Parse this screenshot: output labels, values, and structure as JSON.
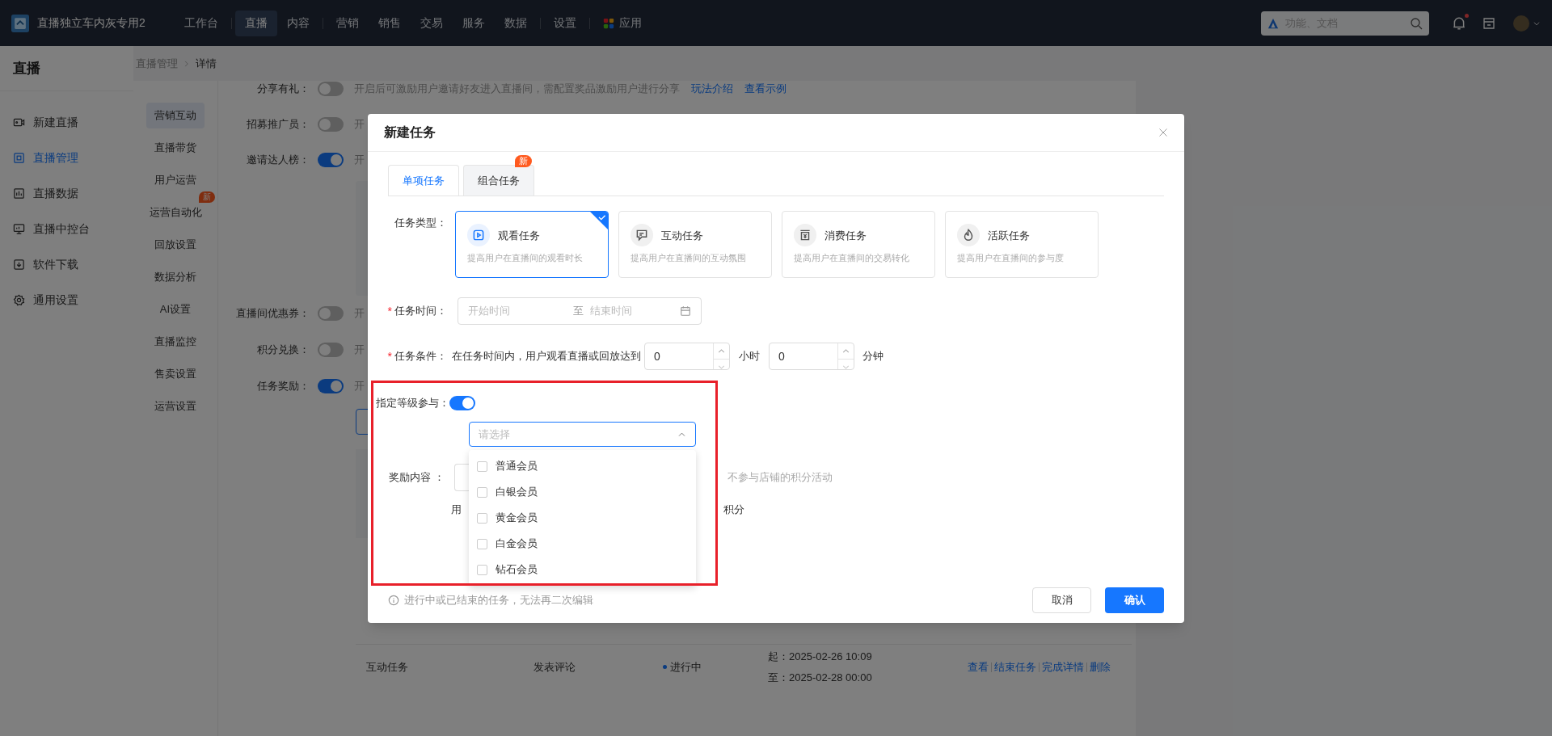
{
  "top_bar": {
    "app_name": "直播独立车内灰专用2",
    "nav": [
      {
        "label": "工作台",
        "selected": false,
        "divider_after": true
      },
      {
        "label": "直播",
        "selected": true,
        "divider_after": false
      },
      {
        "label": "内容",
        "selected": false,
        "divider_after": true
      },
      {
        "label": "营销",
        "selected": false,
        "divider_after": false
      },
      {
        "label": "销售",
        "selected": false,
        "divider_after": false
      },
      {
        "label": "交易",
        "selected": false,
        "divider_after": false
      },
      {
        "label": "服务",
        "selected": false,
        "divider_after": false
      },
      {
        "label": "数据",
        "selected": false,
        "divider_after": true
      },
      {
        "label": "设置",
        "selected": false,
        "divider_after": true
      },
      {
        "label": "应用",
        "selected": false,
        "divider_after": false
      }
    ],
    "search": {
      "placeholder": "功能、文档"
    },
    "unread_notifications": true
  },
  "sidebar": {
    "title": "直播",
    "items": [
      {
        "label": "新建直播",
        "selected": false
      },
      {
        "label": "直播管理",
        "selected": true
      },
      {
        "label": "直播数据",
        "selected": false
      },
      {
        "label": "直播中控台",
        "selected": false
      },
      {
        "label": "软件下载",
        "selected": false
      },
      {
        "label": "通用设置",
        "selected": false
      }
    ]
  },
  "breadcrumb": [
    "直播管理",
    "详情"
  ],
  "submenu": [
    {
      "label": "营销互动",
      "selected": true
    },
    {
      "label": "直播带货",
      "selected": false
    },
    {
      "label": "用户运营",
      "selected": false
    },
    {
      "label": "运营自动化",
      "selected": false,
      "badge": "新"
    },
    {
      "label": "回放设置",
      "selected": false
    },
    {
      "label": "数据分析",
      "selected": false
    },
    {
      "label": "AI设置",
      "selected": false
    },
    {
      "label": "直播监控",
      "selected": false
    },
    {
      "label": "售卖设置",
      "selected": false
    },
    {
      "label": "运营设置",
      "selected": false
    }
  ],
  "settings": [
    {
      "label": "分享有礼：",
      "on": false,
      "description": "开启后可激励用户邀请好友进入直播间，需配置奖品激励用户进行分享",
      "links": [
        "玩法介绍",
        "查看示例"
      ]
    },
    {
      "label": "招募推广员：",
      "on": false,
      "description": "开"
    },
    {
      "label": "邀请达人榜：",
      "on": true,
      "description": "开"
    },
    {
      "label": "直播间优惠券：",
      "on": false,
      "description": "开"
    },
    {
      "label": "积分兑换：",
      "on": false,
      "description": "开"
    },
    {
      "label": "任务奖励：",
      "on": true,
      "description": "开"
    }
  ],
  "task_row": {
    "type": "互动任务",
    "action": "发表评论",
    "status": "进行中",
    "start": "起：2025-02-26 10:09",
    "end": "至：2025-02-28 00:00",
    "actions": [
      "查看",
      "结束任务",
      "完成详情",
      "删除"
    ]
  },
  "dialog": {
    "title": "新建任务",
    "tabs": [
      {
        "label": "单项任务",
        "selected": true
      },
      {
        "label": "组合任务",
        "selected": false,
        "badge": "新"
      }
    ],
    "task_type_label": "任务类型：",
    "task_types": [
      {
        "title": "观看任务",
        "description": "提高用户在直播间的观看时长",
        "selected": true
      },
      {
        "title": "互动任务",
        "description": "提高用户在直播间的互动氛围",
        "selected": false
      },
      {
        "title": "消费任务",
        "description": "提高用户在直播间的交易转化",
        "selected": false
      },
      {
        "title": "活跃任务",
        "description": "提高用户在直播间的参与度",
        "selected": false
      }
    ],
    "time": {
      "label": "任务时间：",
      "required": true,
      "required_mark": "*",
      "start_placeholder": "开始时间",
      "separator": "至",
      "end_placeholder": "结束时间"
    },
    "condition": {
      "label": "任务条件：",
      "required": true,
      "required_mark": "*",
      "text": "在任务时间内，用户观看直播或回放达到",
      "hours": "0",
      "hours_unit": "小时",
      "minutes": "0",
      "minutes_unit": "分钟"
    },
    "level": {
      "label": "指定等级参与：",
      "on": true,
      "placeholder": "请选择",
      "expanded": true,
      "options": [
        {
          "label": "普通会员",
          "checked": false
        },
        {
          "label": "白银会员",
          "checked": false
        },
        {
          "label": "黄金会员",
          "checked": false
        },
        {
          "label": "白金会员",
          "checked": false
        },
        {
          "label": "钻石会员",
          "checked": false
        }
      ]
    },
    "reward": {
      "label": "奖励内容 ：",
      "note": "不参与店铺的积分活动",
      "line2_start": "用",
      "line2_end": "积分"
    },
    "footer_note": "进行中或已结束的任务，无法再二次编辑",
    "cancel": "取消",
    "confirm": "确认"
  }
}
